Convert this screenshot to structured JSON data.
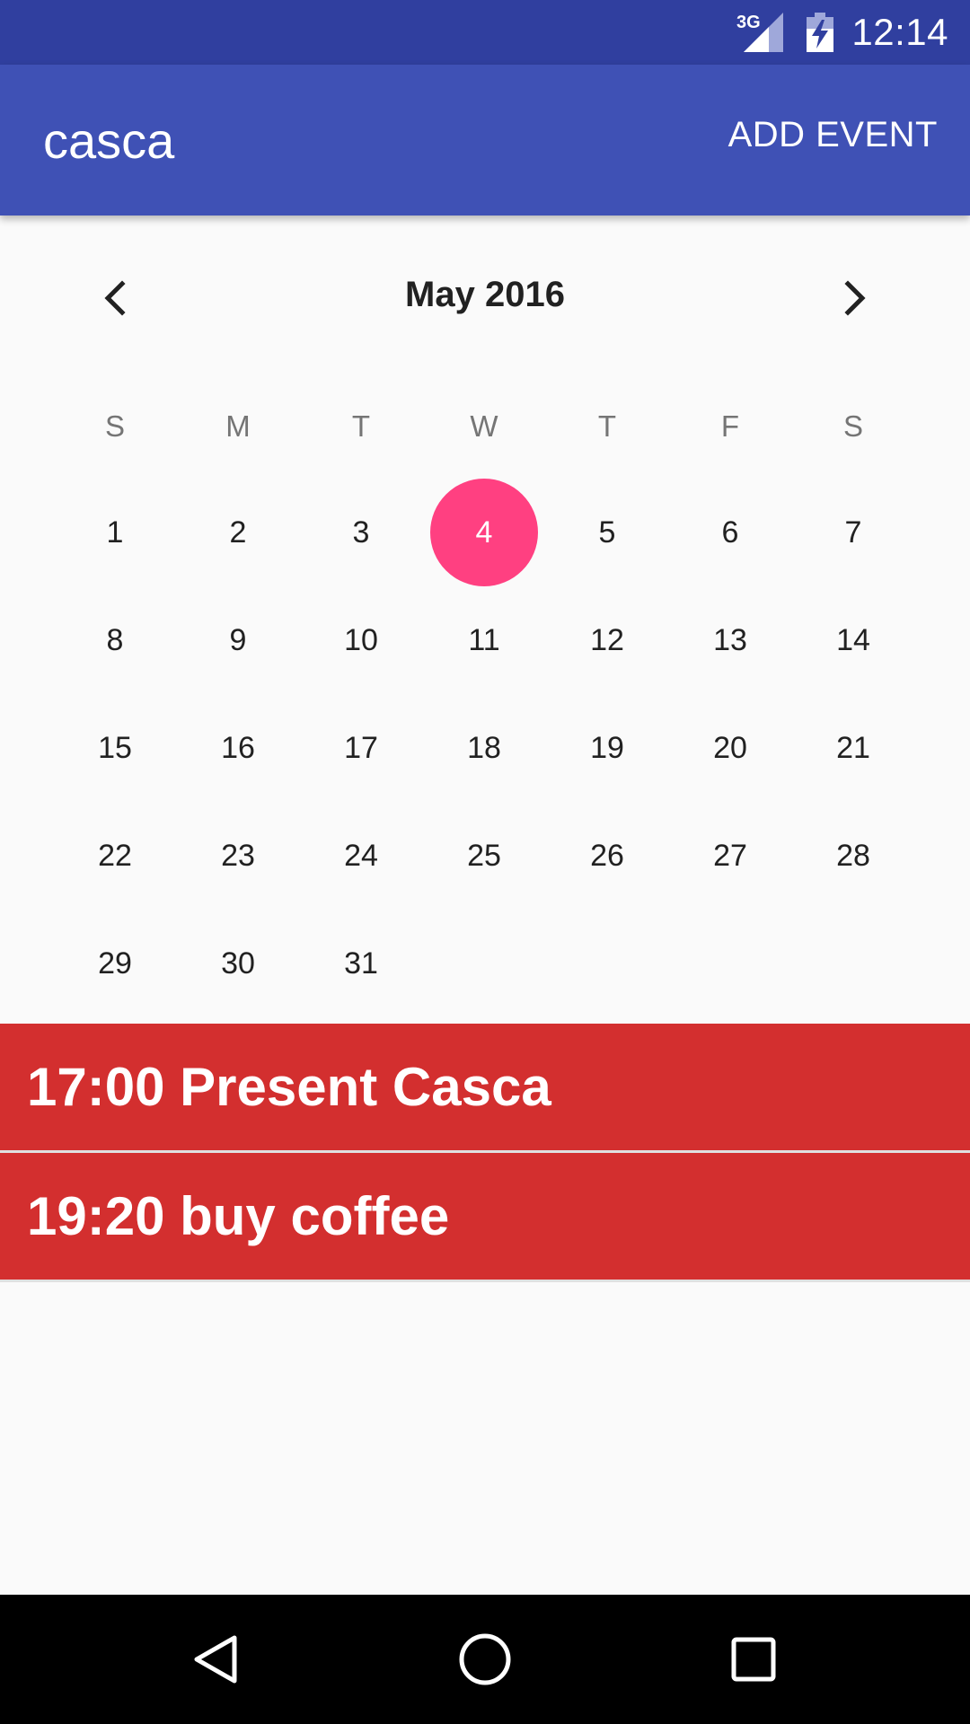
{
  "status_bar": {
    "network": "3G",
    "time": "12:14",
    "signal_icon": "signal-icon",
    "battery_icon": "battery-charging-icon"
  },
  "app_bar": {
    "title": "casca",
    "action_label": "ADD EVENT"
  },
  "calendar": {
    "month_label": "May 2016",
    "prev_icon": "chevron-left-icon",
    "next_icon": "chevron-right-icon",
    "weekdays": [
      "S",
      "M",
      "T",
      "W",
      "T",
      "F",
      "S"
    ],
    "weeks": [
      [
        "1",
        "2",
        "3",
        "4",
        "5",
        "6",
        "7"
      ],
      [
        "8",
        "9",
        "10",
        "11",
        "12",
        "13",
        "14"
      ],
      [
        "15",
        "16",
        "17",
        "18",
        "19",
        "20",
        "21"
      ],
      [
        "22",
        "23",
        "24",
        "25",
        "26",
        "27",
        "28"
      ],
      [
        "29",
        "30",
        "31"
      ]
    ],
    "selected_day": "4",
    "selected_color": "#ff4081"
  },
  "events": [
    {
      "label": "17:00 Present Casca"
    },
    {
      "label": "19:20 buy coffee"
    }
  ],
  "colors": {
    "status_bar": "#303f9f",
    "app_bar": "#3f51b5",
    "event_background": "#d32f2f",
    "background": "#fafafa"
  },
  "nav_bar": {
    "back_icon": "back-icon",
    "home_icon": "home-icon",
    "recents_icon": "recents-icon"
  }
}
